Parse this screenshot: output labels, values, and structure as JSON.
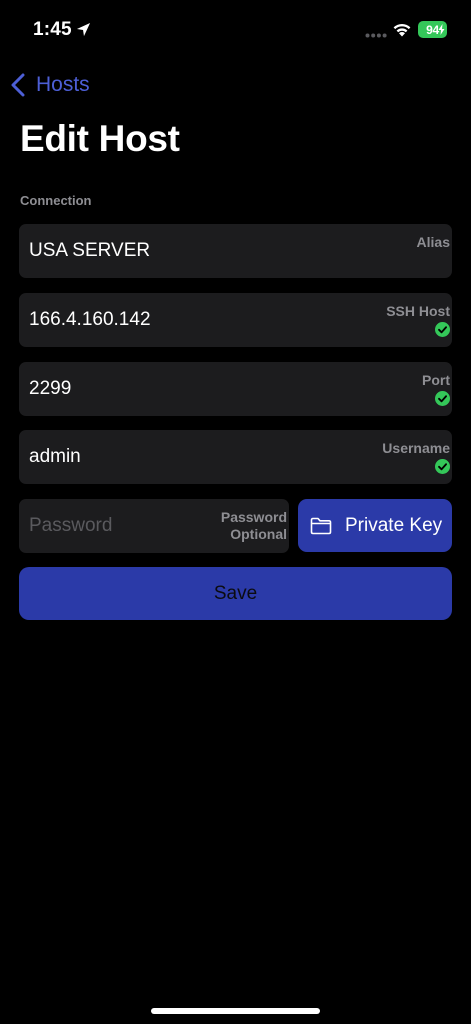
{
  "status_bar": {
    "time": "1:45",
    "battery": "94",
    "icons": [
      "location-arrow-icon",
      "cellular-signal-icon",
      "wifi-icon",
      "battery-charging-icon"
    ]
  },
  "nav": {
    "back_label": "Hosts",
    "back_icon": "chevron-left-icon",
    "accent_color": "#4d5fd6"
  },
  "page": {
    "title": "Edit Host",
    "section_label": "Connection"
  },
  "fields": {
    "alias": {
      "label": "Alias",
      "value": "USA SERVER",
      "valid": false
    },
    "ssh_host": {
      "label": "SSH Host",
      "value": "166.4.160.142",
      "valid": true
    },
    "port": {
      "label": "Port",
      "value": "2299",
      "valid": true
    },
    "username": {
      "label": "Username",
      "value": "admin",
      "valid": true
    },
    "password": {
      "placeholder": "Password",
      "label_line1": "Password",
      "label_line2": "Optional"
    }
  },
  "buttons": {
    "private_key": {
      "label": "Private Key",
      "icon": "folder-icon"
    },
    "save": {
      "label": "Save"
    }
  },
  "colors": {
    "background": "#000000",
    "field_background": "#1c1c1e",
    "button_blue": "#2b3aa8",
    "valid_green": "#34c759",
    "label_gray": "#8e8e93"
  }
}
